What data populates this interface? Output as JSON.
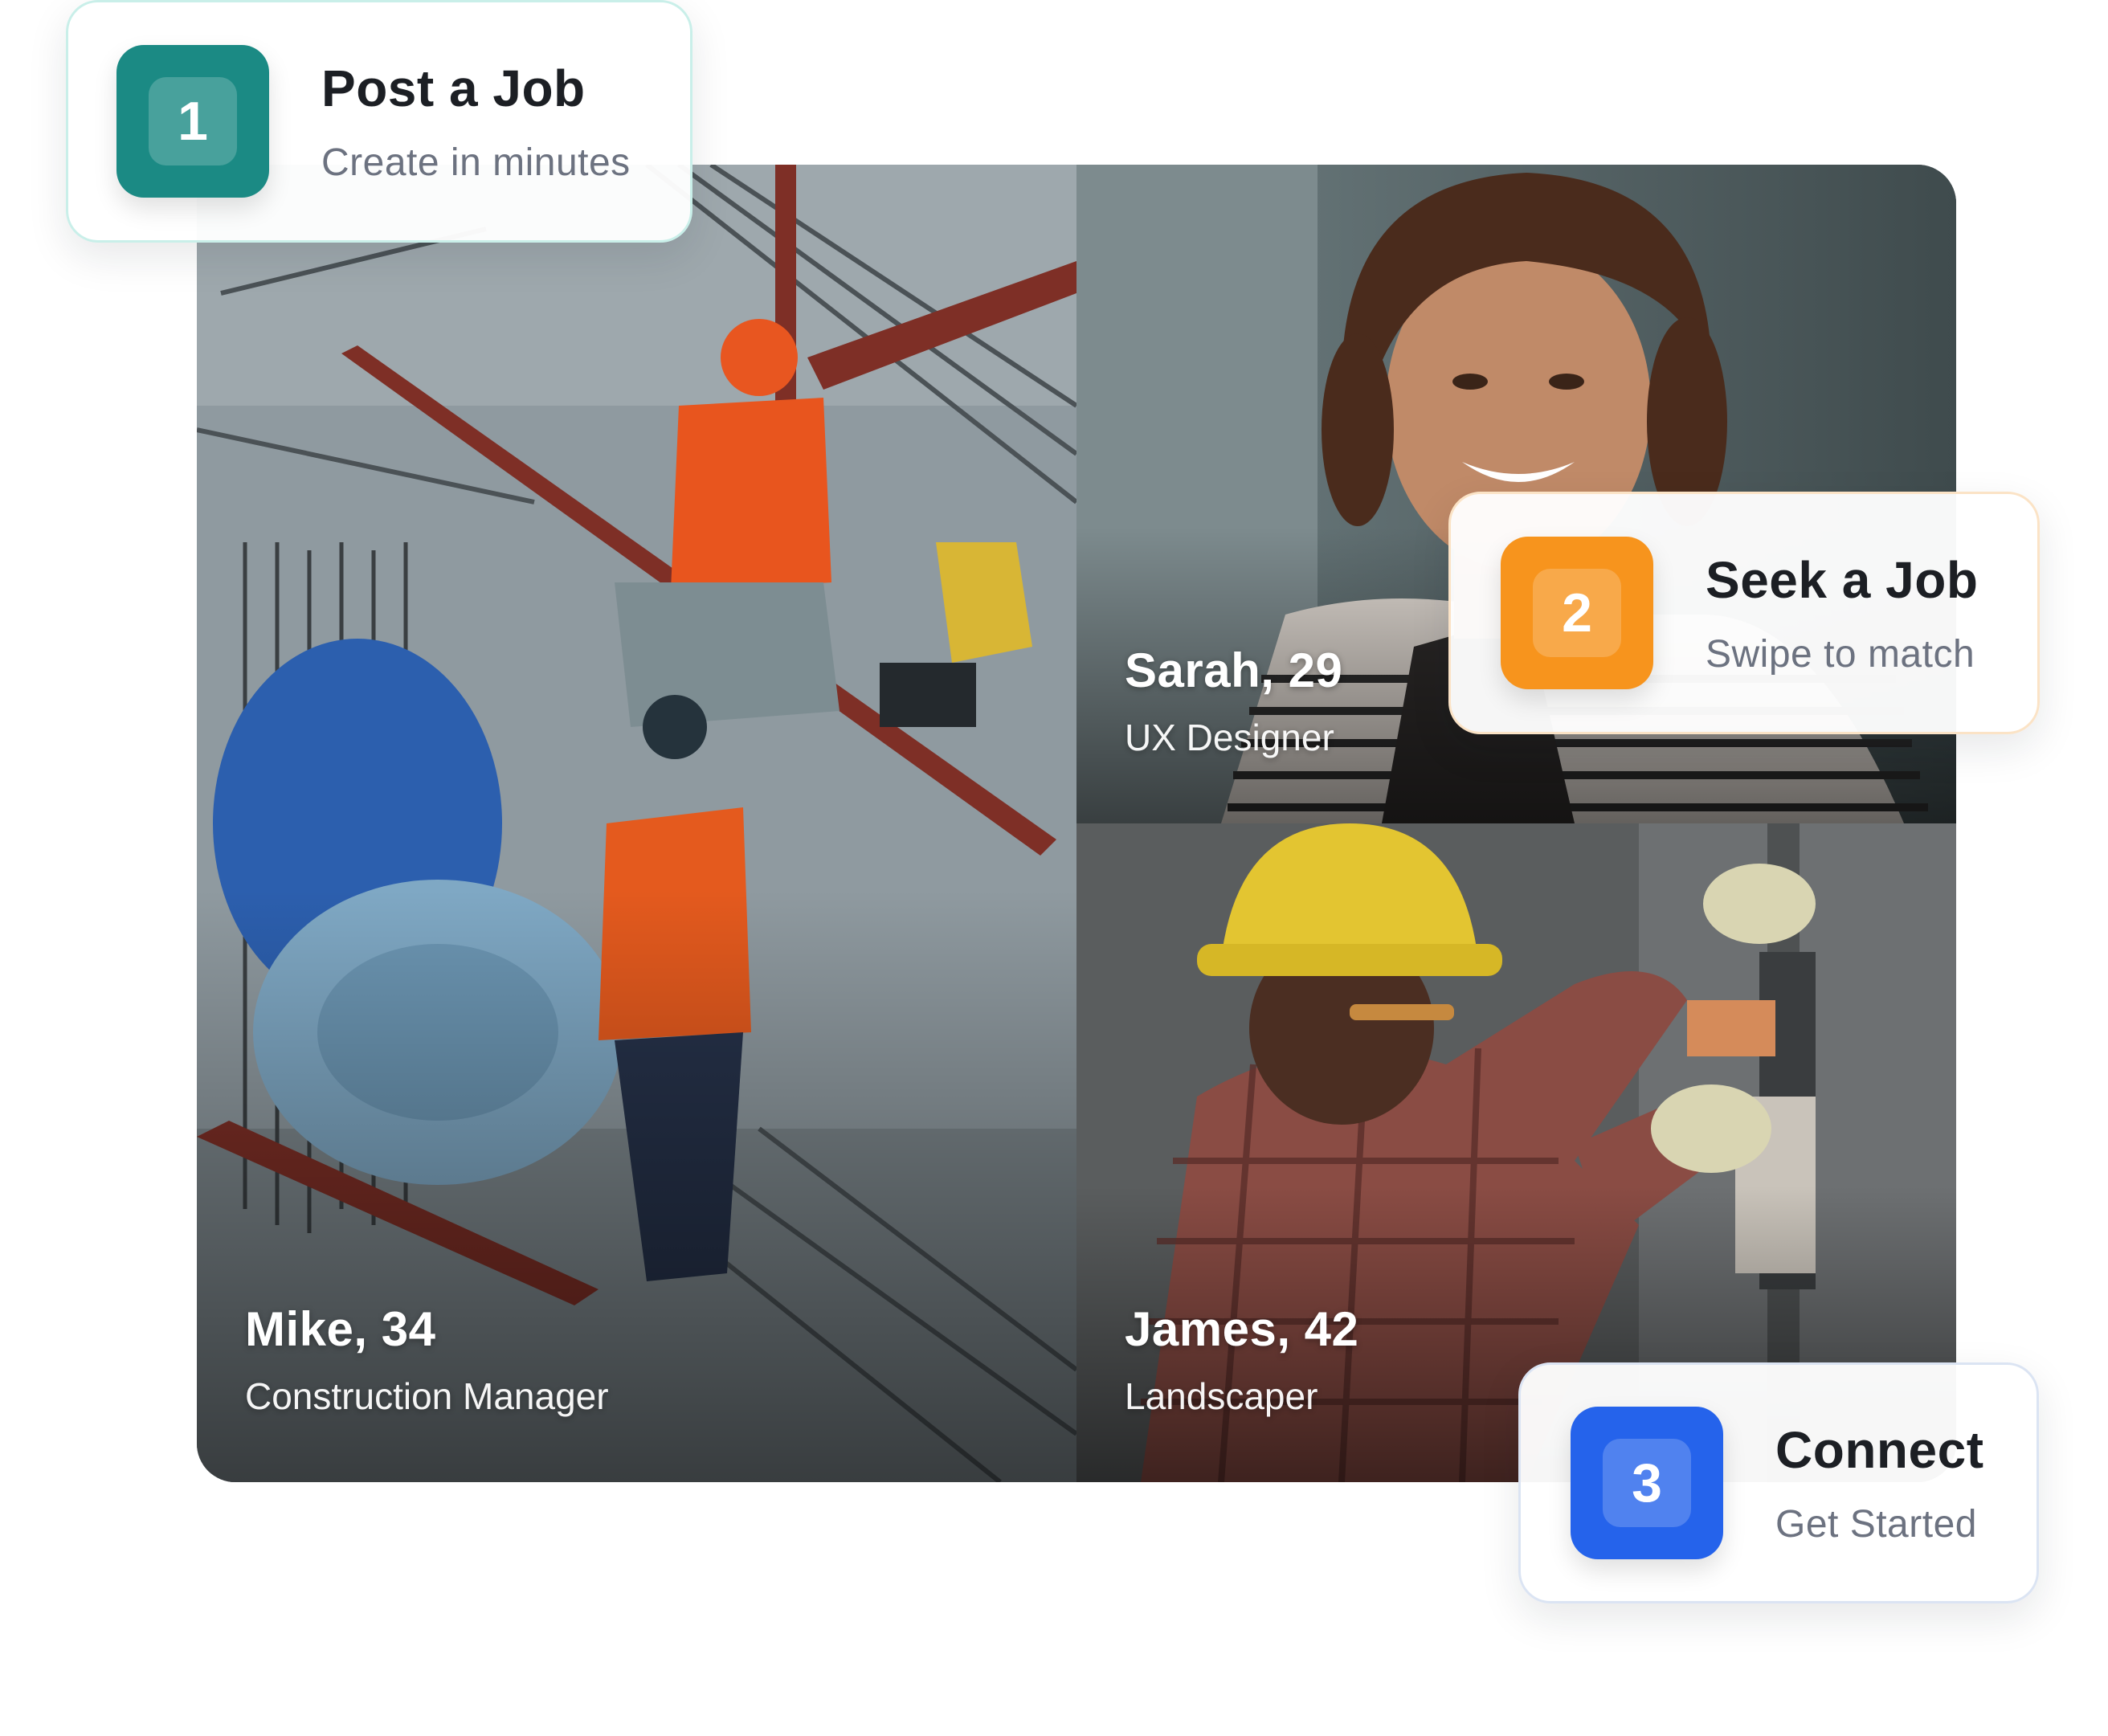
{
  "profiles": [
    {
      "name": "Mike, 34",
      "role": "Construction Manager"
    },
    {
      "name": "Sarah, 29",
      "role": "UX Designer"
    },
    {
      "name": "James, 42",
      "role": "Landscaper"
    }
  ],
  "steps": [
    {
      "number": "1",
      "title": "Post a Job",
      "subtitle": "Create in minutes",
      "color": "#1b8a84"
    },
    {
      "number": "2",
      "title": "Seek a Job",
      "subtitle": "Swipe to match",
      "color": "#f7941d"
    },
    {
      "number": "3",
      "title": "Connect",
      "subtitle": "Get Started",
      "color": "#2563eb"
    }
  ]
}
